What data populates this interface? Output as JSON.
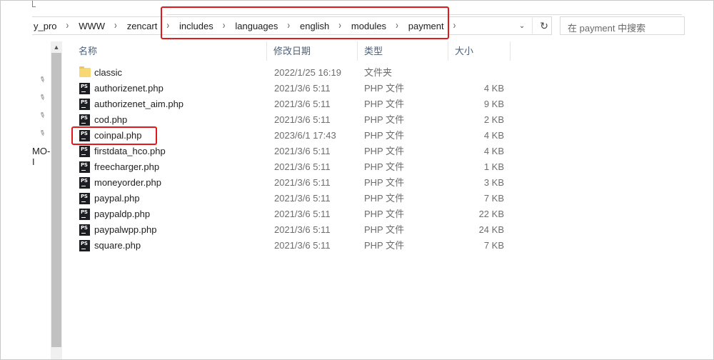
{
  "address_bar": {
    "crumbs": [
      "y_pro",
      "WWW",
      "zencart",
      "includes",
      "languages",
      "english",
      "modules",
      "payment"
    ],
    "separator": "›",
    "dropdown_icon": "chevron-down-icon",
    "refresh_icon": "refresh-icon"
  },
  "search": {
    "placeholder": "在 payment 中搜索"
  },
  "nav": {
    "partial_label": "MO-I",
    "pin_icon": "pin-icon"
  },
  "columns": {
    "name": "名称",
    "date": "修改日期",
    "type": "类型",
    "size": "大小"
  },
  "files": [
    {
      "icon": "folder-icon",
      "name": "classic",
      "date": "2022/1/25 16:19",
      "type": "文件夹",
      "size": ""
    },
    {
      "icon": "phpstorm-file-icon",
      "name": "authorizenet.php",
      "date": "2021/3/6 5:11",
      "type": "PHP 文件",
      "size": "4 KB"
    },
    {
      "icon": "phpstorm-file-icon",
      "name": "authorizenet_aim.php",
      "date": "2021/3/6 5:11",
      "type": "PHP 文件",
      "size": "9 KB"
    },
    {
      "icon": "phpstorm-file-icon",
      "name": "cod.php",
      "date": "2021/3/6 5:11",
      "type": "PHP 文件",
      "size": "2 KB"
    },
    {
      "icon": "phpstorm-file-icon",
      "name": "coinpal.php",
      "date": "2023/6/1 17:43",
      "type": "PHP 文件",
      "size": "4 KB"
    },
    {
      "icon": "phpstorm-file-icon",
      "name": "firstdata_hco.php",
      "date": "2021/3/6 5:11",
      "type": "PHP 文件",
      "size": "4 KB"
    },
    {
      "icon": "phpstorm-file-icon",
      "name": "freecharger.php",
      "date": "2021/3/6 5:11",
      "type": "PHP 文件",
      "size": "1 KB"
    },
    {
      "icon": "phpstorm-file-icon",
      "name": "moneyorder.php",
      "date": "2021/3/6 5:11",
      "type": "PHP 文件",
      "size": "3 KB"
    },
    {
      "icon": "phpstorm-file-icon",
      "name": "paypal.php",
      "date": "2021/3/6 5:11",
      "type": "PHP 文件",
      "size": "7 KB"
    },
    {
      "icon": "phpstorm-file-icon",
      "name": "paypaldp.php",
      "date": "2021/3/6 5:11",
      "type": "PHP 文件",
      "size": "22 KB"
    },
    {
      "icon": "phpstorm-file-icon",
      "name": "paypalwpp.php",
      "date": "2021/3/6 5:11",
      "type": "PHP 文件",
      "size": "24 KB"
    },
    {
      "icon": "phpstorm-file-icon",
      "name": "square.php",
      "date": "2021/3/6 5:11",
      "type": "PHP 文件",
      "size": "7 KB"
    }
  ],
  "ps_label": "PS",
  "colors": {
    "highlight": "#e0191b",
    "header_text": "#4c607a",
    "secondary_text": "#6d6d6d",
    "folder": "#f8d775",
    "php_icon": "#1d1d24"
  }
}
